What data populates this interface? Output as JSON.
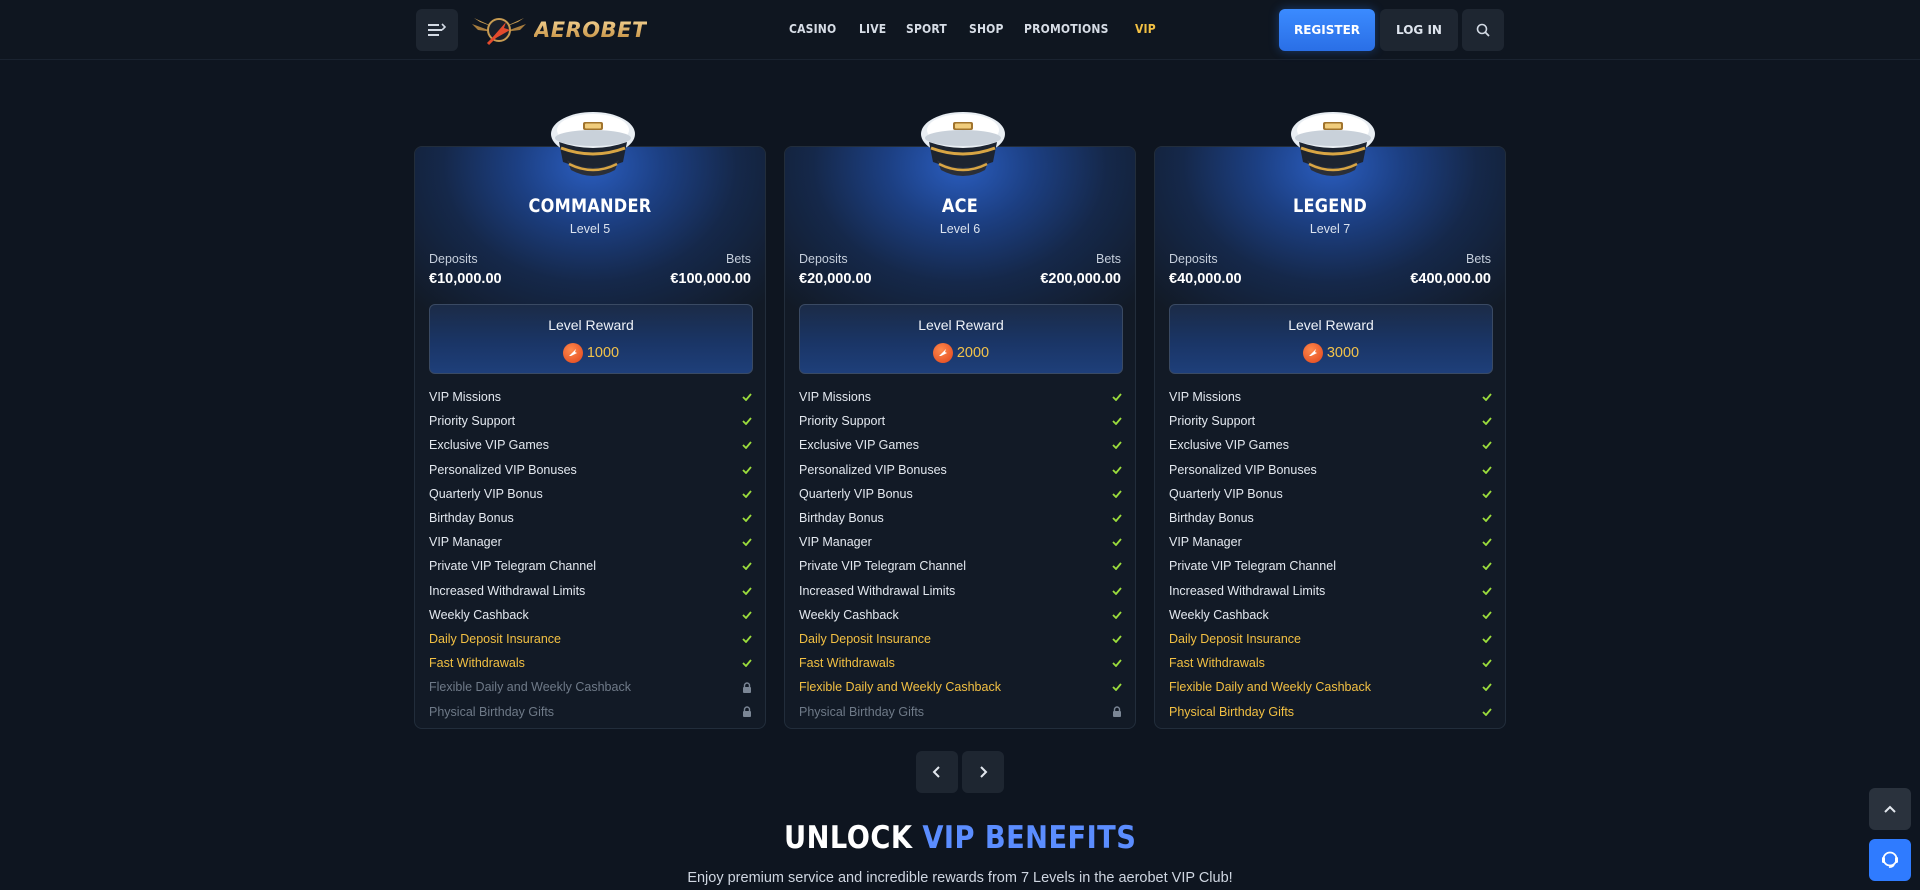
{
  "brand": {
    "name": "AEROBET"
  },
  "nav": [
    {
      "label": "CASINO",
      "active": false
    },
    {
      "label": "LIVE",
      "active": false
    },
    {
      "label": "SPORT",
      "active": false
    },
    {
      "label": "SHOP",
      "active": false
    },
    {
      "label": "PROMOTIONS",
      "active": false
    },
    {
      "label": "VIP",
      "active": true
    }
  ],
  "header": {
    "register_label": "REGISTER",
    "login_label": "LOG IN"
  },
  "labels": {
    "deposits": "Deposits",
    "bets": "Bets",
    "level_reward": "Level Reward"
  },
  "tiers": [
    {
      "name": "COMMANDER",
      "level": "Level 5",
      "deposits": "€10,000.00",
      "bets": "€100,000.00",
      "reward": "1000",
      "features": [
        {
          "label": "VIP Missions",
          "status": "included"
        },
        {
          "label": "Priority Support",
          "status": "included"
        },
        {
          "label": "Exclusive VIP Games",
          "status": "included"
        },
        {
          "label": "Personalized VIP Bonuses",
          "status": "included"
        },
        {
          "label": "Quarterly VIP Bonus",
          "status": "included"
        },
        {
          "label": "Birthday Bonus",
          "status": "included"
        },
        {
          "label": "VIP Manager",
          "status": "included"
        },
        {
          "label": "Private VIP Telegram Channel",
          "status": "included"
        },
        {
          "label": "Increased Withdrawal Limits",
          "status": "included"
        },
        {
          "label": "Weekly Cashback",
          "status": "included"
        },
        {
          "label": "Daily Deposit Insurance",
          "status": "gold"
        },
        {
          "label": "Fast Withdrawals",
          "status": "gold"
        },
        {
          "label": "Flexible Daily and Weekly Cashback",
          "status": "locked"
        },
        {
          "label": "Physical Birthday Gifts",
          "status": "locked"
        }
      ]
    },
    {
      "name": "ACE",
      "level": "Level 6",
      "deposits": "€20,000.00",
      "bets": "€200,000.00",
      "reward": "2000",
      "features": [
        {
          "label": "VIP Missions",
          "status": "included"
        },
        {
          "label": "Priority Support",
          "status": "included"
        },
        {
          "label": "Exclusive VIP Games",
          "status": "included"
        },
        {
          "label": "Personalized VIP Bonuses",
          "status": "included"
        },
        {
          "label": "Quarterly VIP Bonus",
          "status": "included"
        },
        {
          "label": "Birthday Bonus",
          "status": "included"
        },
        {
          "label": "VIP Manager",
          "status": "included"
        },
        {
          "label": "Private VIP Telegram Channel",
          "status": "included"
        },
        {
          "label": "Increased Withdrawal Limits",
          "status": "included"
        },
        {
          "label": "Weekly Cashback",
          "status": "included"
        },
        {
          "label": "Daily Deposit Insurance",
          "status": "gold"
        },
        {
          "label": "Fast Withdrawals",
          "status": "gold"
        },
        {
          "label": "Flexible Daily and Weekly Cashback",
          "status": "gold"
        },
        {
          "label": "Physical Birthday Gifts",
          "status": "locked"
        }
      ]
    },
    {
      "name": "LEGEND",
      "level": "Level 7",
      "deposits": "€40,000.00",
      "bets": "€400,000.00",
      "reward": "3000",
      "features": [
        {
          "label": "VIP Missions",
          "status": "included"
        },
        {
          "label": "Priority Support",
          "status": "included"
        },
        {
          "label": "Exclusive VIP Games",
          "status": "included"
        },
        {
          "label": "Personalized VIP Bonuses",
          "status": "included"
        },
        {
          "label": "Quarterly VIP Bonus",
          "status": "included"
        },
        {
          "label": "Birthday Bonus",
          "status": "included"
        },
        {
          "label": "VIP Manager",
          "status": "included"
        },
        {
          "label": "Private VIP Telegram Channel",
          "status": "included"
        },
        {
          "label": "Increased Withdrawal Limits",
          "status": "included"
        },
        {
          "label": "Weekly Cashback",
          "status": "included"
        },
        {
          "label": "Daily Deposit Insurance",
          "status": "gold"
        },
        {
          "label": "Fast Withdrawals",
          "status": "gold"
        },
        {
          "label": "Flexible Daily and Weekly Cashback",
          "status": "gold"
        },
        {
          "label": "Physical Birthday Gifts",
          "status": "gold"
        }
      ]
    }
  ],
  "section": {
    "title_white": "UNLOCK",
    "title_blue": "VIP BENEFITS",
    "subtitle": "Enjoy premium service and incredible rewards from 7 Levels in the aerobet VIP Club!"
  },
  "colors": {
    "accent_gold": "#f2c043",
    "accent_blue": "#2f7bff",
    "check_green": "#9bdc3c",
    "background": "#0e1520"
  },
  "icons": [
    "menu-icon",
    "search-icon",
    "checkmark-icon",
    "lock-icon",
    "chevron-left-icon",
    "chevron-right-icon",
    "arrow-up-icon",
    "chat-icon",
    "reward-coin-icon",
    "captain-hat-icon"
  ]
}
